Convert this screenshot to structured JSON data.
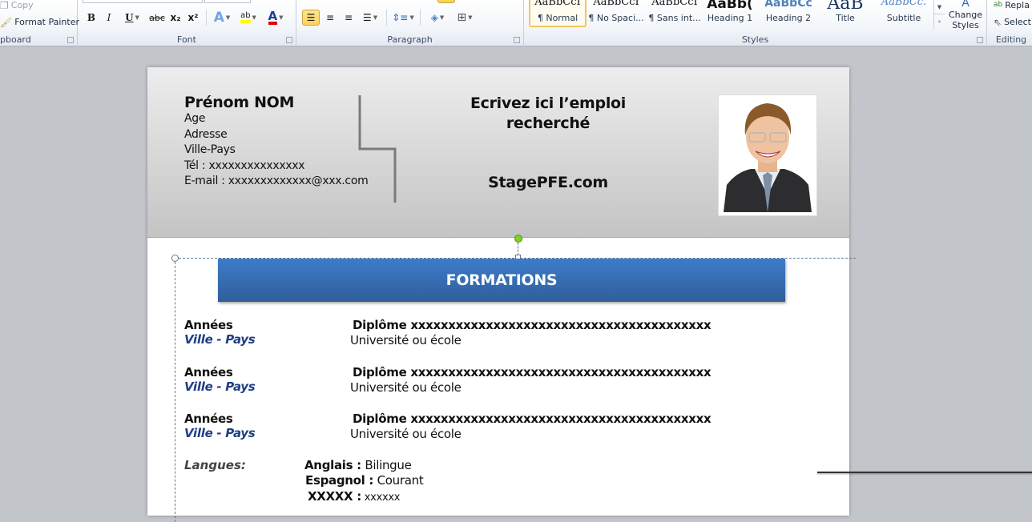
{
  "ribbon": {
    "clipboard": {
      "label": "Clipboard",
      "label_visible": "pboard",
      "copy": "Copy",
      "format_painter": "Format Painter"
    },
    "font": {
      "label": "Font",
      "bold": "B",
      "italic": "I",
      "underline": "U",
      "strikethrough": "abc",
      "subscript": "x₂",
      "superscript": "x²",
      "text_effects": "A",
      "highlight": "ab",
      "font_color": "A",
      "highlight_color": "#ffff00",
      "font_color_value": "#e00000"
    },
    "paragraph": {
      "label": "Paragraph"
    },
    "styles": {
      "label": "Styles",
      "items": [
        {
          "preview": "AaBbCcI",
          "name": "¶ Normal",
          "selected": true
        },
        {
          "preview": "AaBbCcI",
          "name": "¶ No Spaci...",
          "selected": false
        },
        {
          "preview": "AaBbCcI",
          "name": "¶ Sans int...",
          "selected": false
        },
        {
          "preview": "AaBb(",
          "name": "Heading 1",
          "selected": false
        },
        {
          "preview": "AaBbCc",
          "name": "Heading 2",
          "selected": false
        },
        {
          "preview": "AaB",
          "name": "Title",
          "selected": false
        },
        {
          "preview": "AaBbCc.",
          "name": "Subtitle",
          "selected": false
        }
      ],
      "change_styles": "Change Styles"
    },
    "editing": {
      "label": "Editing",
      "replace": "Replace",
      "replace_visible": "Repla",
      "select": "Select",
      "select_visible": "Select"
    }
  },
  "document": {
    "header": {
      "name": "Prénom NOM",
      "age": "Age",
      "address": "Adresse",
      "city_country": "Ville-Pays",
      "phone": "Tél  : xxxxxxxxxxxxxxx",
      "email": "E-mail  : xxxxxxxxxxxxx@xxx.com",
      "job_title_line1": "Ecrivez ici l’emploi",
      "job_title_line2": "recherché",
      "website": "StagePFE.com"
    },
    "section_title": "FORMATIONS",
    "education": [
      {
        "years": "Années",
        "location": "Ville - Pays",
        "diploma": "Diplôme xxxxxxxxxxxxxxxxxxxxxxxxxxxxxxxxxxxxxxxx",
        "school": "Université ou école"
      },
      {
        "years": "Années",
        "location": "Ville - Pays",
        "diploma": "Diplôme xxxxxxxxxxxxxxxxxxxxxxxxxxxxxxxxxxxxxxxx",
        "school": "Université ou école"
      },
      {
        "years": "Années",
        "location": "Ville - Pays",
        "diploma": "Diplôme xxxxxxxxxxxxxxxxxxxxxxxxxxxxxxxxxxxxxxxx",
        "school": "Université ou école"
      }
    ],
    "languages": {
      "label": "Langues:",
      "items": [
        {
          "name": "Anglais :",
          "level": " Bilingue"
        },
        {
          "name": "Espagnol :",
          "level": " Courant"
        },
        {
          "name": "XXXXX :",
          "level": " xxxxxx"
        }
      ]
    }
  }
}
